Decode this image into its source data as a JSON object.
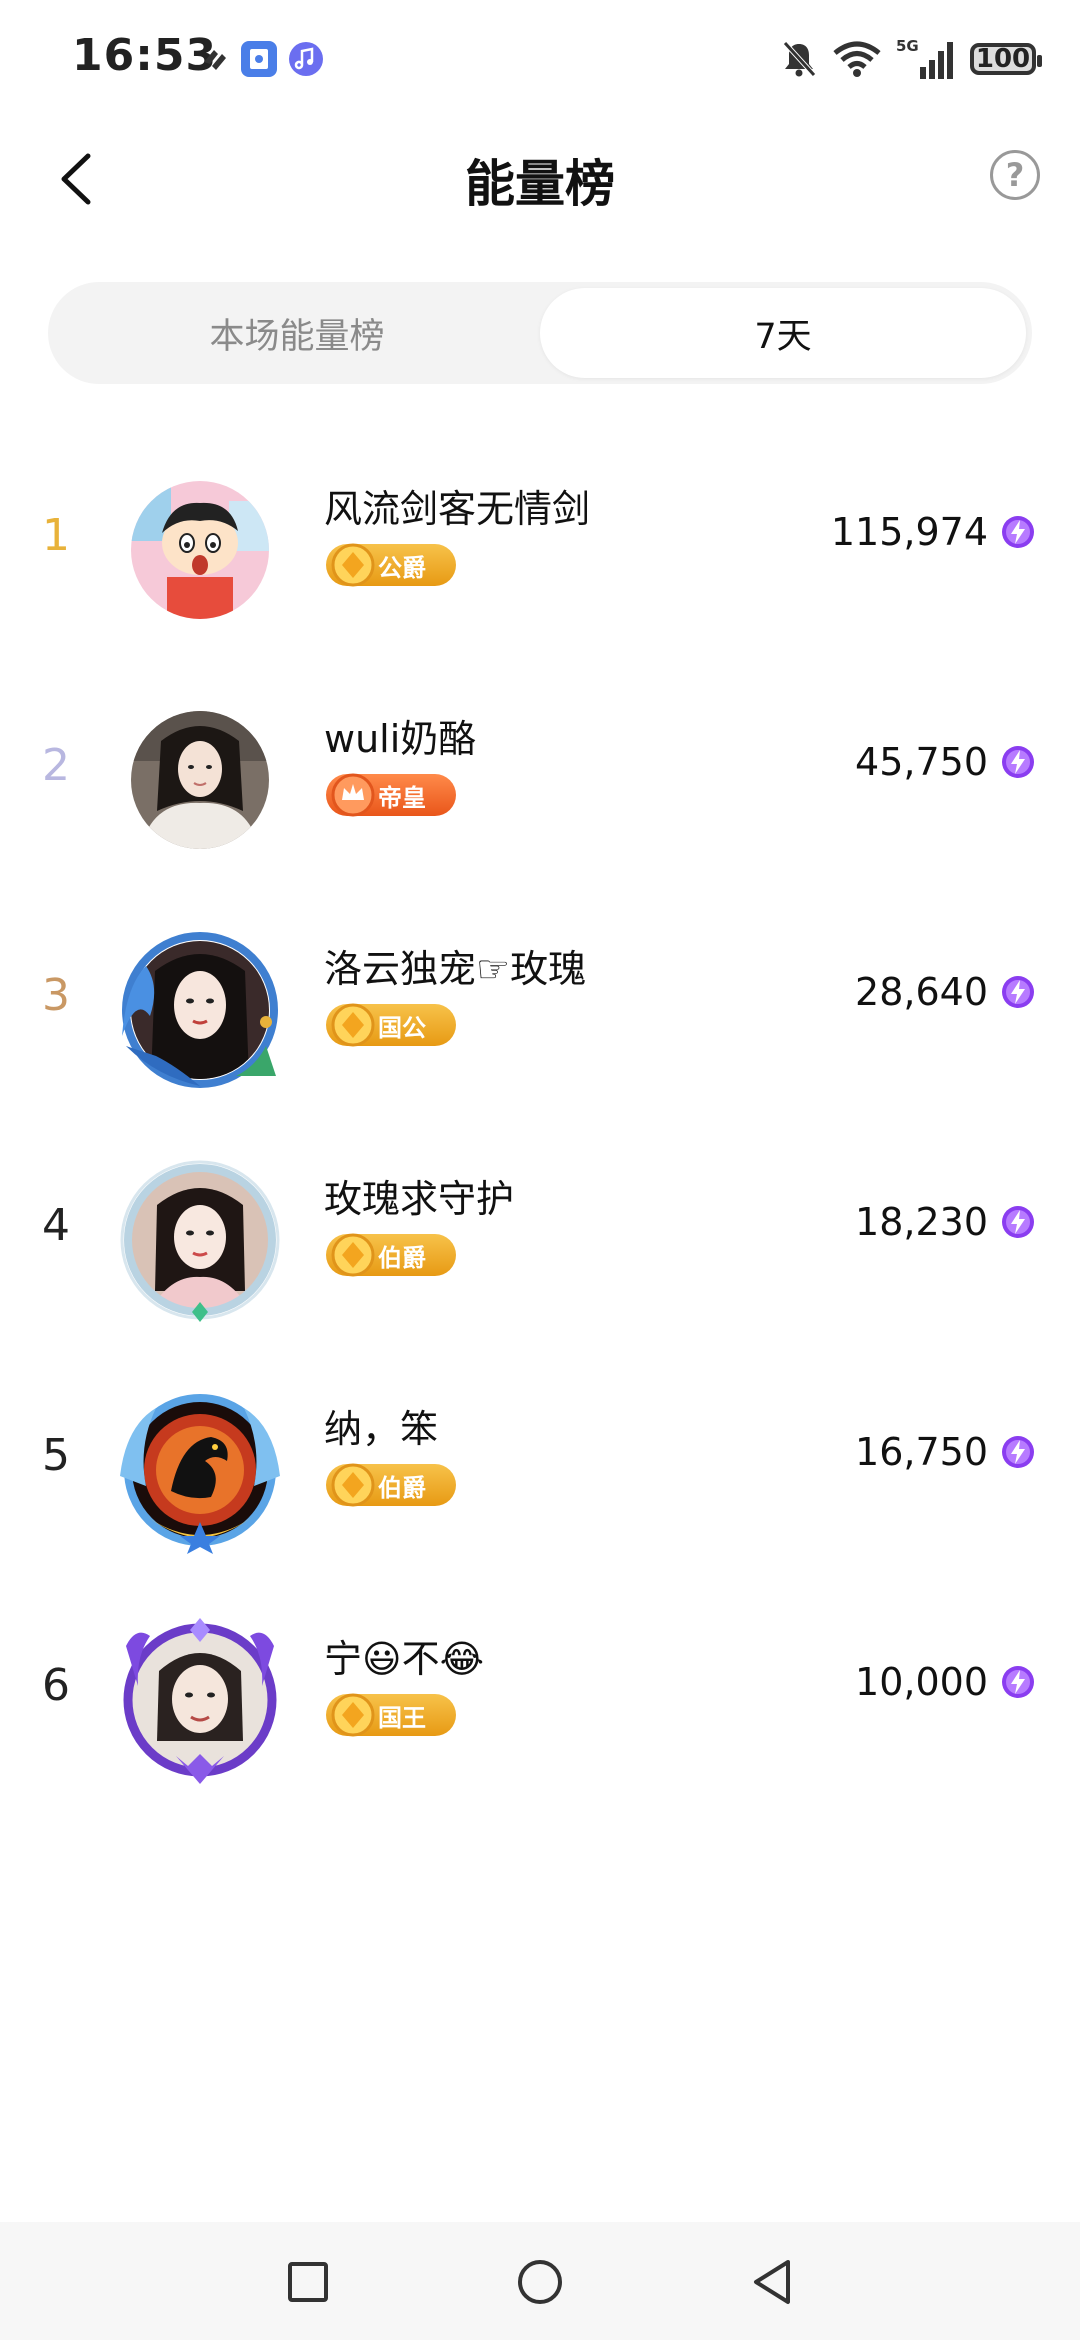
{
  "status": {
    "time": "16:53",
    "battery": "100",
    "network": "5G"
  },
  "header": {
    "title": "能量榜",
    "help": "?"
  },
  "tabs": [
    {
      "label": "本场能量榜",
      "active": false
    },
    {
      "label": "7天",
      "active": true
    }
  ],
  "ranking": [
    {
      "rank": "1",
      "rank_color": "#e8b23a",
      "name": "风流剑客无情剑",
      "badge": "公爵",
      "badge_style": "gold",
      "score": "115,974"
    },
    {
      "rank": "2",
      "rank_color": "#b8b7e0",
      "name": "wuli奶酪",
      "badge": "帝皇",
      "badge_style": "orange",
      "score": "45,750"
    },
    {
      "rank": "3",
      "rank_color": "#c99864",
      "name": "洛云独宠☞玫瑰",
      "badge": "国公",
      "badge_style": "gold",
      "score": "28,640"
    },
    {
      "rank": "4",
      "rank_color": "#222222",
      "name": "玫瑰求守护",
      "badge": "伯爵",
      "badge_style": "gold",
      "score": "18,230"
    },
    {
      "rank": "5",
      "rank_color": "#222222",
      "name": "纳，笨",
      "badge": "伯爵",
      "badge_style": "gold",
      "score": "16,750"
    },
    {
      "rank": "6",
      "rank_color": "#222222",
      "name": "宁😃不😂",
      "badge": "国王",
      "badge_style": "gold",
      "score": "10,000"
    }
  ],
  "icons": {
    "score_icon": "energy-bolt-icon",
    "nav": [
      "recent-apps-icon",
      "home-icon",
      "back-triangle-icon"
    ]
  },
  "colors": {
    "energy": "#8a3df0",
    "badge_gold": "#f0ac2a",
    "badge_orange": "#f06a2c"
  }
}
